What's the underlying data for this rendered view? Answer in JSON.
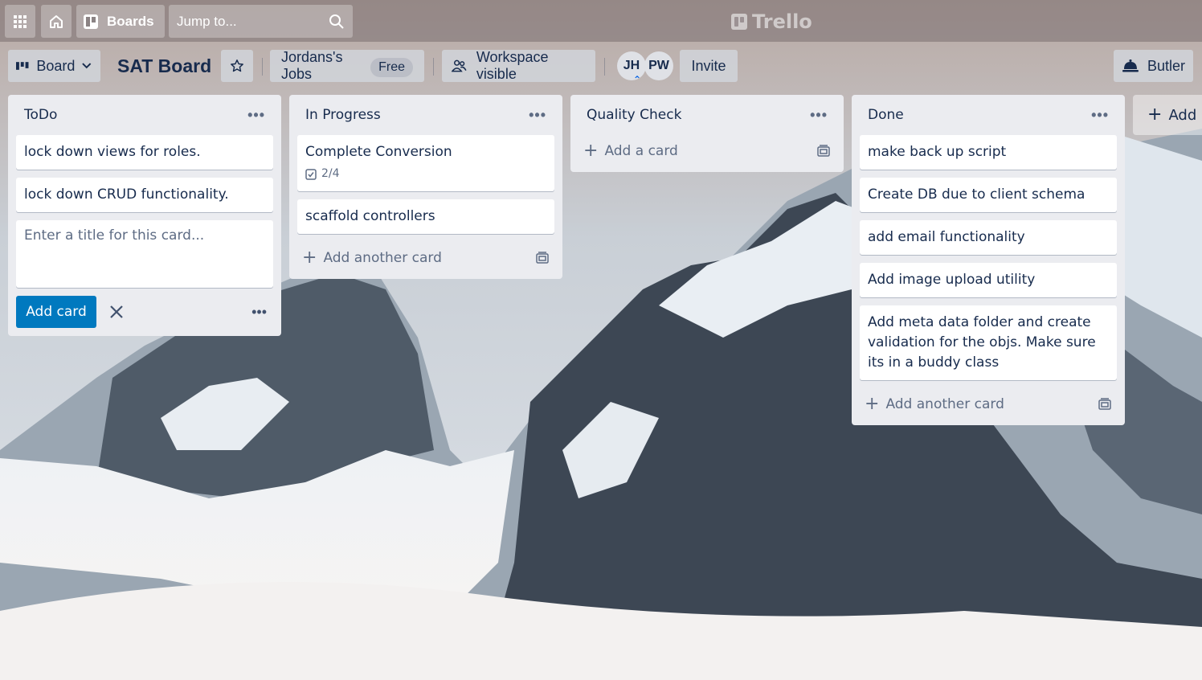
{
  "topnav": {
    "boards_label": "Boards",
    "search_placeholder": "Jump to...",
    "logo_text": "Trello"
  },
  "header": {
    "view_label": "Board",
    "board_title": "SAT Board",
    "workspace_name": "Jordans's Jobs",
    "workspace_plan": "Free",
    "visibility_label": "Workspace visible",
    "members": [
      "JH",
      "PW"
    ],
    "invite_label": "Invite",
    "butler_label": "Butler"
  },
  "lists": [
    {
      "title": "ToDo",
      "cards": [
        "lock down views for roles.",
        "lock down CRUD functionality."
      ],
      "composer_placeholder": "Enter a title for this card...",
      "add_card_button": "Add card"
    },
    {
      "title": "In Progress",
      "cards": [
        "Complete Conversion",
        "scaffold controllers"
      ],
      "checklist_badge": "2/4",
      "add_label": "Add another card"
    },
    {
      "title": "Quality Check",
      "cards": [],
      "add_label": "Add a card"
    },
    {
      "title": "Done",
      "cards": [
        "make back up script",
        "Create DB due to client schema",
        "add email functionality",
        "Add image upload utility",
        "Add meta data folder and create validation for the objs. Make sure its in a buddy class"
      ],
      "add_label": "Add another card"
    }
  ],
  "add_list_label": "Add another list",
  "colors": {
    "list_bg": "#ebecf0",
    "primary_button": "#0079bf",
    "text": "#172b4d",
    "muted_text": "#5e6c84"
  }
}
